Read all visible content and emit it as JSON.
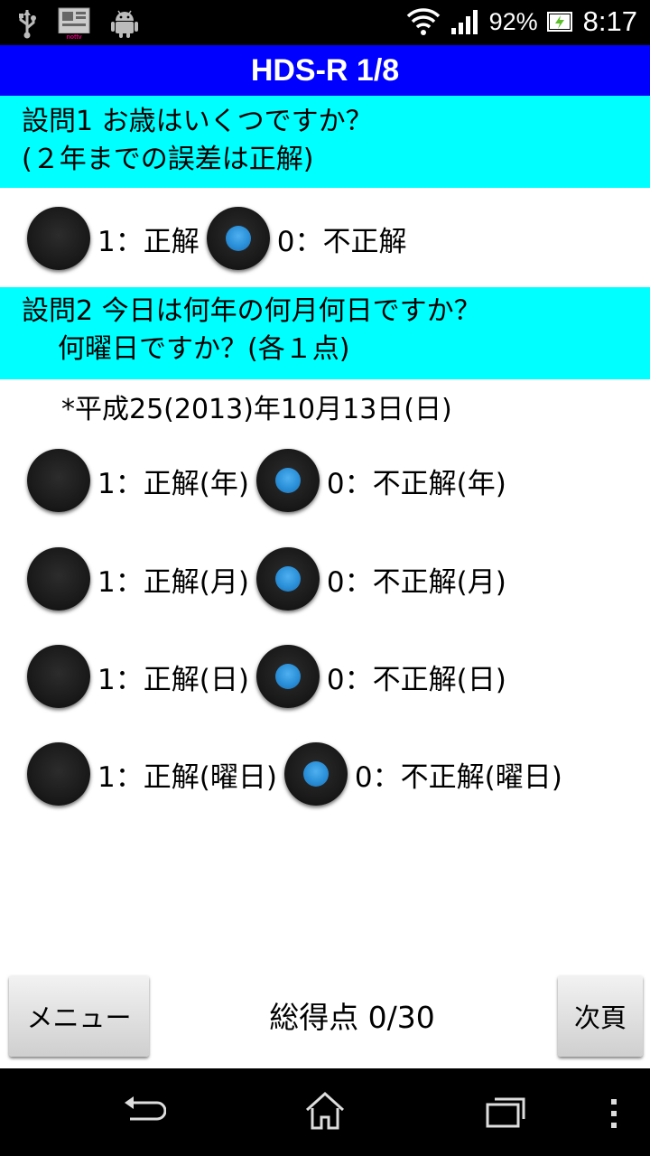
{
  "status_bar": {
    "left_icons": [
      "usb-icon",
      "news-app-icon",
      "android-icon"
    ],
    "news_icon_text": "nottv",
    "battery_percent": "92%",
    "time": "8:17"
  },
  "app": {
    "title": "HDS-R 1/8"
  },
  "question1": {
    "line1": "設問1 お歳はいくつですか？",
    "line2": "(２年までの誤差は正解)",
    "options": [
      {
        "label": "1：正解",
        "checked": false
      },
      {
        "label": "0：不正解",
        "checked": true
      }
    ]
  },
  "question2": {
    "line1": "設問2 今日は何年の何月何日ですか？",
    "line2": "何曜日ですか？(各１点)",
    "hint": "*平成25(2013)年10月13日(日)",
    "rows": [
      {
        "correct": "1：正解(年)",
        "incorrect": "0：不正解(年)"
      },
      {
        "correct": "1：正解(月)",
        "incorrect": "0：不正解(月)"
      },
      {
        "correct": "1：正解(日)",
        "incorrect": "0：不正解(日)"
      },
      {
        "correct": "1：正解(曜日)",
        "incorrect": "0：不正解(曜日)"
      }
    ]
  },
  "footer": {
    "menu_label": "メニュー",
    "score_text": "総得点 0/30",
    "next_label": "次頁"
  },
  "colors": {
    "title_bg": "#0000ff",
    "question_bg": "#00ffff",
    "radio_check": "#2a8fd8"
  }
}
